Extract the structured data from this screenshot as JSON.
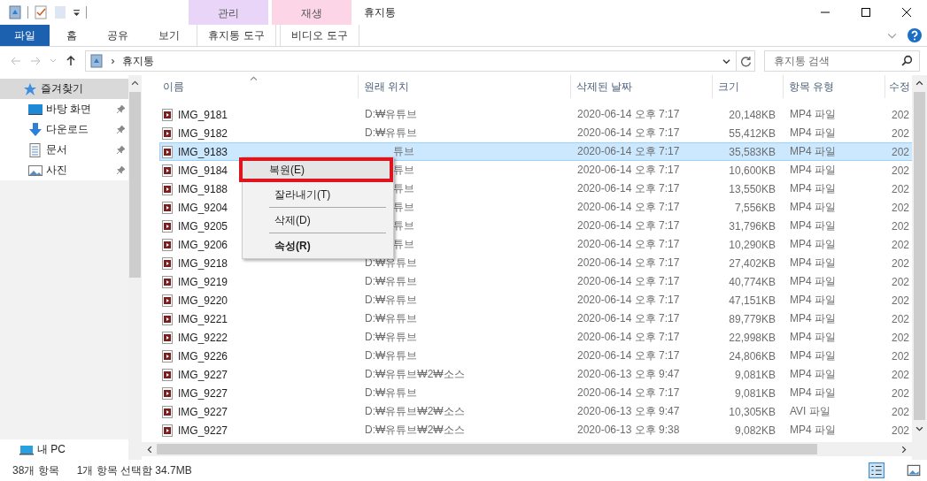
{
  "window": {
    "title": "휴지통"
  },
  "context_tabs": [
    {
      "group": "관리",
      "tab": "휴지통 도구",
      "color": "#e8d5f7"
    },
    {
      "group": "재생",
      "tab": "비디오 도구",
      "color": "#fcd6e6"
    }
  ],
  "ribbon_tabs": [
    {
      "label": "파일",
      "selected": true
    },
    {
      "label": "홈",
      "selected": false
    },
    {
      "label": "공유",
      "selected": false
    },
    {
      "label": "보기",
      "selected": false
    }
  ],
  "address": {
    "path": "휴지통"
  },
  "search": {
    "placeholder": "휴지통 검색"
  },
  "sidebar": {
    "items": [
      {
        "label": "즐겨찾기",
        "kind": "group",
        "selected": true,
        "pinned": false
      },
      {
        "label": "바탕 화면",
        "kind": "desktop",
        "selected": false,
        "pinned": true
      },
      {
        "label": "다운로드",
        "kind": "download",
        "selected": false,
        "pinned": true
      },
      {
        "label": "문서",
        "kind": "document",
        "selected": false,
        "pinned": true
      },
      {
        "label": "사진",
        "kind": "photo",
        "selected": false,
        "pinned": true
      }
    ],
    "bottom_item": "내 PC"
  },
  "table": {
    "columns": [
      "이름",
      "원래 위치",
      "삭제된 날짜",
      "크기",
      "항목 유형",
      "수정"
    ],
    "rows": [
      {
        "name": "IMG_9181",
        "location": "D:₩유튜브",
        "location_cut": false,
        "deleted": "2020-06-14 오후 7:17",
        "size": "20,148KB",
        "type": "MP4 파일",
        "column_6": "202",
        "selected": false
      },
      {
        "name": "IMG_9182",
        "location": "D:₩유튜브",
        "location_cut": false,
        "deleted": "2020-06-14 오후 7:17",
        "size": "55,412KB",
        "type": "MP4 파일",
        "column_6": "202",
        "selected": false
      },
      {
        "name": "IMG_9183",
        "location": "튜브",
        "location_cut": true,
        "deleted": "2020-06-14 오후 7:17",
        "size": "35,583KB",
        "type": "MP4 파일",
        "column_6": "202",
        "selected": true
      },
      {
        "name": "IMG_9184",
        "location": "튜브",
        "location_cut": true,
        "deleted": "2020-06-14 오후 7:17",
        "size": "10,600KB",
        "type": "MP4 파일",
        "column_6": "202",
        "selected": false
      },
      {
        "name": "IMG_9188",
        "location": "튜브",
        "location_cut": true,
        "deleted": "2020-06-14 오후 7:17",
        "size": "13,550KB",
        "type": "MP4 파일",
        "column_6": "202",
        "selected": false
      },
      {
        "name": "IMG_9204",
        "location": "튜브",
        "location_cut": true,
        "deleted": "2020-06-14 오후 7:17",
        "size": "7,556KB",
        "type": "MP4 파일",
        "column_6": "202",
        "selected": false
      },
      {
        "name": "IMG_9205",
        "location": "튜브",
        "location_cut": true,
        "deleted": "2020-06-14 오후 7:17",
        "size": "31,796KB",
        "type": "MP4 파일",
        "column_6": "202",
        "selected": false
      },
      {
        "name": "IMG_9206",
        "location": "튜브",
        "location_cut": true,
        "deleted": "2020-06-14 오후 7:17",
        "size": "10,290KB",
        "type": "MP4 파일",
        "column_6": "202",
        "selected": false
      },
      {
        "name": "IMG_9218",
        "location": "D:₩유튜브",
        "location_cut": false,
        "deleted": "2020-06-14 오후 7:17",
        "size": "27,402KB",
        "type": "MP4 파일",
        "column_6": "202",
        "selected": false
      },
      {
        "name": "IMG_9219",
        "location": "D:₩유튜브",
        "location_cut": false,
        "deleted": "2020-06-14 오후 7:17",
        "size": "40,774KB",
        "type": "MP4 파일",
        "column_6": "202",
        "selected": false
      },
      {
        "name": "IMG_9220",
        "location": "D:₩유튜브",
        "location_cut": false,
        "deleted": "2020-06-14 오후 7:17",
        "size": "47,151KB",
        "type": "MP4 파일",
        "column_6": "202",
        "selected": false
      },
      {
        "name": "IMG_9221",
        "location": "D:₩유튜브",
        "location_cut": false,
        "deleted": "2020-06-14 오후 7:17",
        "size": "89,779KB",
        "type": "MP4 파일",
        "column_6": "202",
        "selected": false
      },
      {
        "name": "IMG_9222",
        "location": "D:₩유튜브",
        "location_cut": false,
        "deleted": "2020-06-14 오후 7:17",
        "size": "22,998KB",
        "type": "MP4 파일",
        "column_6": "202",
        "selected": false
      },
      {
        "name": "IMG_9226",
        "location": "D:₩유튜브",
        "location_cut": false,
        "deleted": "2020-06-14 오후 7:17",
        "size": "24,806KB",
        "type": "MP4 파일",
        "column_6": "202",
        "selected": false
      },
      {
        "name": "IMG_9227",
        "location": "D:₩유튜브₩2₩소스",
        "location_cut": false,
        "deleted": "2020-06-13 오후 9:47",
        "size": "9,081KB",
        "type": "MP4 파일",
        "column_6": "202",
        "selected": false
      },
      {
        "name": "IMG_9227",
        "location": "D:₩유튜브",
        "location_cut": false,
        "deleted": "2020-06-14 오후 7:17",
        "size": "9,081KB",
        "type": "MP4 파일",
        "column_6": "202",
        "selected": false
      },
      {
        "name": "IMG_9227",
        "location": "D:₩유튜브₩2₩소스",
        "location_cut": false,
        "deleted": "2020-06-13 오후 9:47",
        "size": "10,305KB",
        "type": "AVI 파일",
        "column_6": "202",
        "selected": false
      },
      {
        "name": "IMG_9227",
        "location": "D:₩유튜브₩2₩소스",
        "location_cut": false,
        "deleted": "2020-06-13 오후 9:38",
        "size": "9,082KB",
        "type": "MP4 파일",
        "column_6": "202",
        "selected": false
      }
    ]
  },
  "context_menu": {
    "items": [
      {
        "label": "복원(E)",
        "kind": "item",
        "bold": false,
        "outlined": true
      },
      {
        "label": "잘라내기(T)",
        "kind": "item",
        "bold": false,
        "outlined": false
      },
      {
        "kind": "separator"
      },
      {
        "label": "삭제(D)",
        "kind": "item",
        "bold": false,
        "outlined": false
      },
      {
        "kind": "separator"
      },
      {
        "label": "속성(R)",
        "kind": "item",
        "bold": true,
        "outlined": false
      }
    ]
  },
  "status_bar": {
    "count": "38개 항목",
    "selection": "1개 항목 선택함 34.7MB"
  }
}
